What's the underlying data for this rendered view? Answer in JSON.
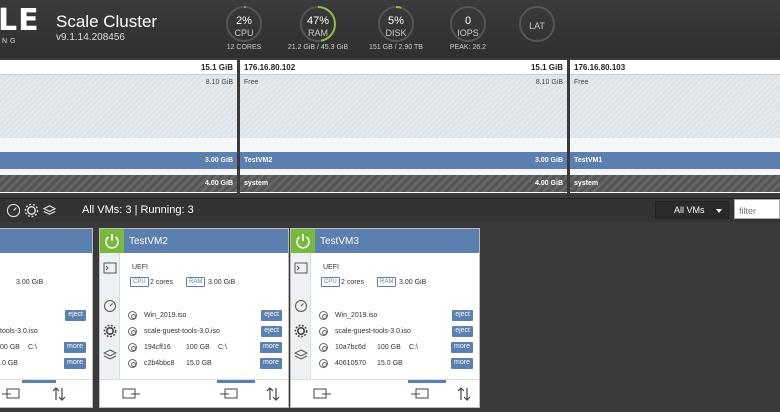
{
  "header": {
    "logo_big": "LE",
    "logo_small": "NG",
    "title": "Scale Cluster",
    "version": "v9.1.14.208456"
  },
  "gauges": [
    {
      "name": "cpu",
      "pct": "2%",
      "label": "CPU",
      "sub": "12 CORES",
      "level": 0.02,
      "color": "#8a8a8a"
    },
    {
      "name": "ram",
      "pct": "47%",
      "label": "RAM",
      "sub": "21.2 GiB / 45.3 GiB",
      "level": 0.47,
      "color": "#8dbf45"
    },
    {
      "name": "disk",
      "pct": "5%",
      "label": "DISK",
      "sub": "151 GB / 2.90 TB",
      "level": 0.05,
      "color": "#8dbf45"
    },
    {
      "name": "iops",
      "pct": "0",
      "label": "IOPS",
      "sub": "PEAK: 26.2",
      "level": 0,
      "color": "#8a8a8a"
    },
    {
      "name": "lat",
      "pct": "",
      "label": "LAT",
      "sub": "",
      "level": 0,
      "color": "#8a8a8a"
    }
  ],
  "nodes": [
    {
      "ip": "",
      "mem": "15.1 GiB",
      "free_label": "",
      "free_mem": "8.10 GiB",
      "vm_label": "",
      "vm_mem": "3.00 GiB",
      "sys_label": "",
      "sys_mem": "4.00 GiB"
    },
    {
      "ip": "176.16.80.102",
      "mem": "15.1 GiB",
      "free_label": "Free",
      "free_mem": "8.10 GiB",
      "vm_label": "TestVM2",
      "vm_mem": "3.00 GiB",
      "sys_label": "system",
      "sys_mem": "4.00 GiB"
    },
    {
      "ip": "176.16.80.103",
      "mem": "",
      "free_label": "Free",
      "free_mem": "",
      "vm_label": "TestVM1",
      "vm_mem": "",
      "sys_label": "system",
      "sys_mem": ""
    }
  ],
  "toolbar": {
    "vm_count": "All VMs: 3 | Running: 3",
    "select_value": "All VMs",
    "filter_placeholder": "filter"
  },
  "partial_card": {
    "mem": "3.00 GiB",
    "iso": "tools-3.0.iso",
    "disk1_size": "00 GB",
    "disk1_path": "C:\\",
    "disk2_size": ".0 GB",
    "eject": "eject",
    "more": "more"
  },
  "cards": [
    {
      "name": "TestVM2",
      "boot": "UEFI",
      "cpu_tag": "CPU",
      "cores": "2 cores",
      "ram_tag": "RAM",
      "mem": "3.00 GiB",
      "iso1": "Win_2019.iso",
      "iso2": "scale-guest-tools-3.0.iso",
      "disk1_id": "194cff16",
      "disk1_size": "100 GB",
      "disk1_path": "C:\\",
      "disk2_id": "c2b4bbc8",
      "disk2_size": "15.0 GB",
      "eject": "eject",
      "more": "more"
    },
    {
      "name": "TestVM3",
      "boot": "UEFI",
      "cpu_tag": "CPU",
      "cores": "2 cores",
      "ram_tag": "RAM",
      "mem": "3.00 GiB",
      "iso1": "Win_2019.iso",
      "iso2": "scale-guest-tools-3.0.iso",
      "disk1_id": "10a7bc6d",
      "disk1_size": "100 GB",
      "disk1_path": "C:\\",
      "disk2_id": "40610570",
      "disk2_size": "15.0 GB",
      "eject": "eject",
      "more": "more"
    }
  ],
  "icons": {
    "toolbar": [
      "gauge-icon",
      "gear-icon",
      "layers-icon"
    ],
    "card_side": [
      "console-icon",
      "gauge-icon",
      "gear-icon",
      "layers-icon"
    ],
    "card_footer": [
      "export-icon",
      "import-icon",
      "move-icon"
    ]
  },
  "colors": {
    "accent": "#5b7fae",
    "power_on": "#78b83a",
    "gauge_good": "#8dbf45"
  }
}
